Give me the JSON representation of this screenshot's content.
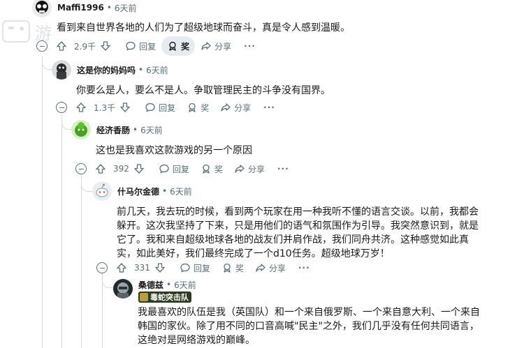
{
  "comments": [
    {
      "author": "Maffi1996",
      "time": "6天前",
      "body": "看到来自世界各地的人们为了超级地球而奋斗，真是令人感到温暖。",
      "votes": "2.9千",
      "reply": "回复",
      "award": "奖",
      "share": "分享",
      "more": "···"
    },
    {
      "author": "这是你的妈妈吗",
      "time": "6天前",
      "body": "你要么是人，要么不是人。争取管理民主的斗争没有国界。",
      "votes": "1.3千",
      "reply": "回复",
      "award": "奖",
      "share": "分享",
      "more": "···"
    },
    {
      "author": "经济香肠",
      "time": "6天前",
      "body": "这也是我喜欢这款游戏的另一个原因",
      "votes": "392",
      "reply": "回复",
      "award": "奖",
      "share": "分享",
      "more": "···"
    },
    {
      "author": "什马尔金德",
      "time": "6天前",
      "body": "前几天，我去玩的时候，看到两个玩家在用一种我听不懂的语言交谈。以前，我都会躲开。这次我坚持了下来，只是用他们的语气和氛围作为引导。我突然意识到，就是它了。我和来自超级地球各地的战友们并肩作战，我们同舟共济。这种感觉如此真实，如此美好，我们最终完成了一个d10任务。超级地球万岁！",
      "votes": "331",
      "reply": "回复",
      "award": "奖",
      "share": "分享",
      "more": "···"
    },
    {
      "author": "桑德兹",
      "time": "6天前",
      "flair": "毒蛇突击队",
      "body": "我最喜欢的队伍是我（英国队）和一个来自俄罗斯、一个来自意大利、一个来自韩国的家伙。除了用不同的口音高喊\"民主\"之外，我们几乎没有任何共同语言，这绝对是网络游戏的巅峰。"
    }
  ],
  "colors": {
    "meta": "#576f76",
    "text": "#1a1a1b",
    "thread": "#d7dadc",
    "award_bg": "#e5ebee",
    "flair_bg": "#2d3b1f"
  },
  "icons": [
    "upvote-icon",
    "downvote-icon",
    "reply-icon",
    "award-icon",
    "share-icon",
    "collapse-icon"
  ]
}
